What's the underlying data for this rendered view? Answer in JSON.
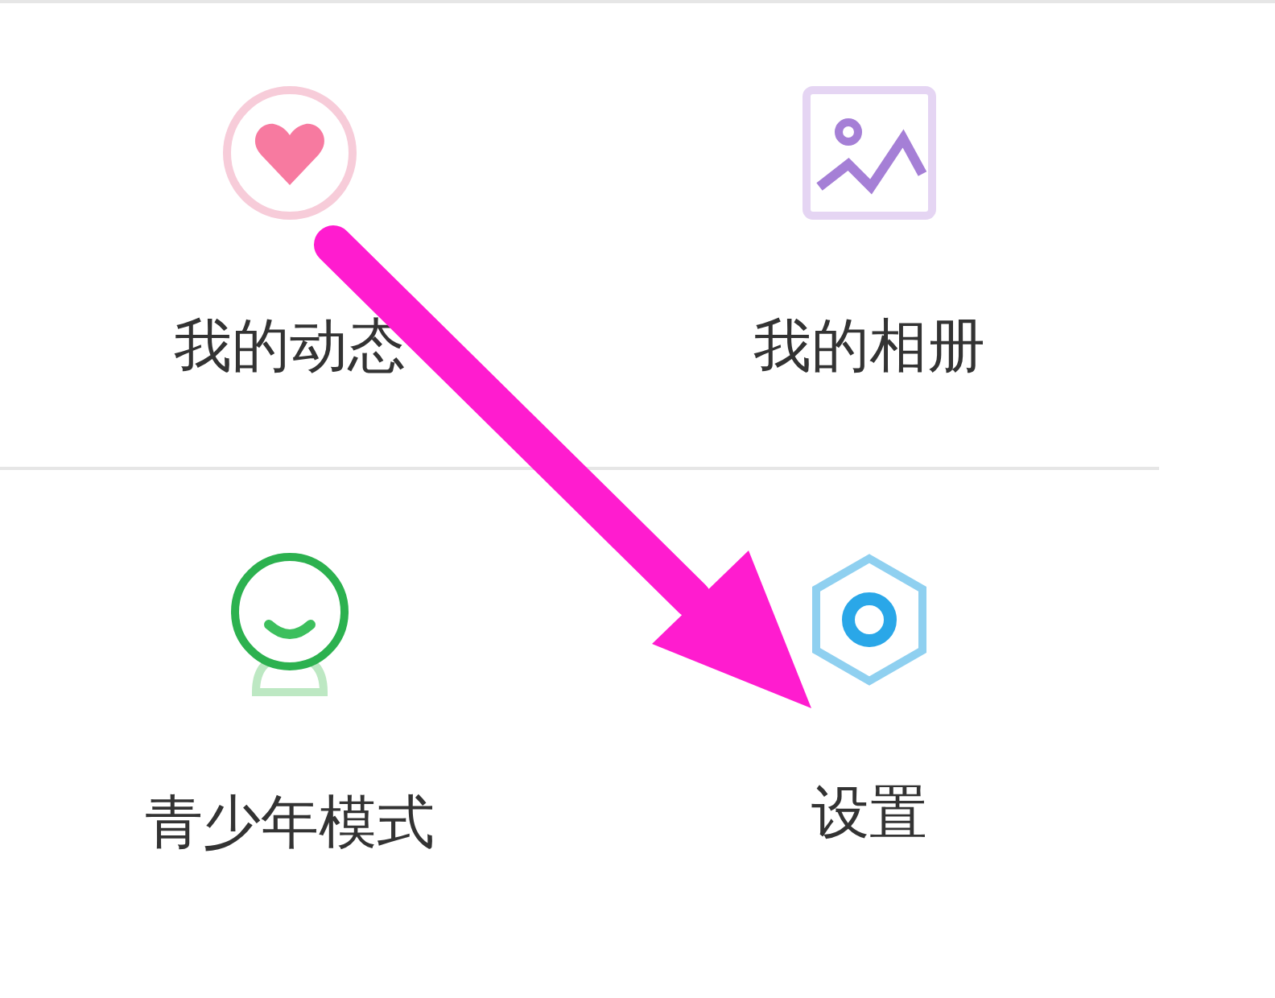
{
  "menu": {
    "items": [
      {
        "kind": "heart",
        "label": "我的动态"
      },
      {
        "kind": "album",
        "label": "我的相册"
      },
      {
        "kind": "youth",
        "label": "青少年模式"
      },
      {
        "kind": "settings",
        "label": "设置"
      }
    ]
  },
  "annotation": {
    "kind": "arrow",
    "color": "#ff1ccf"
  }
}
